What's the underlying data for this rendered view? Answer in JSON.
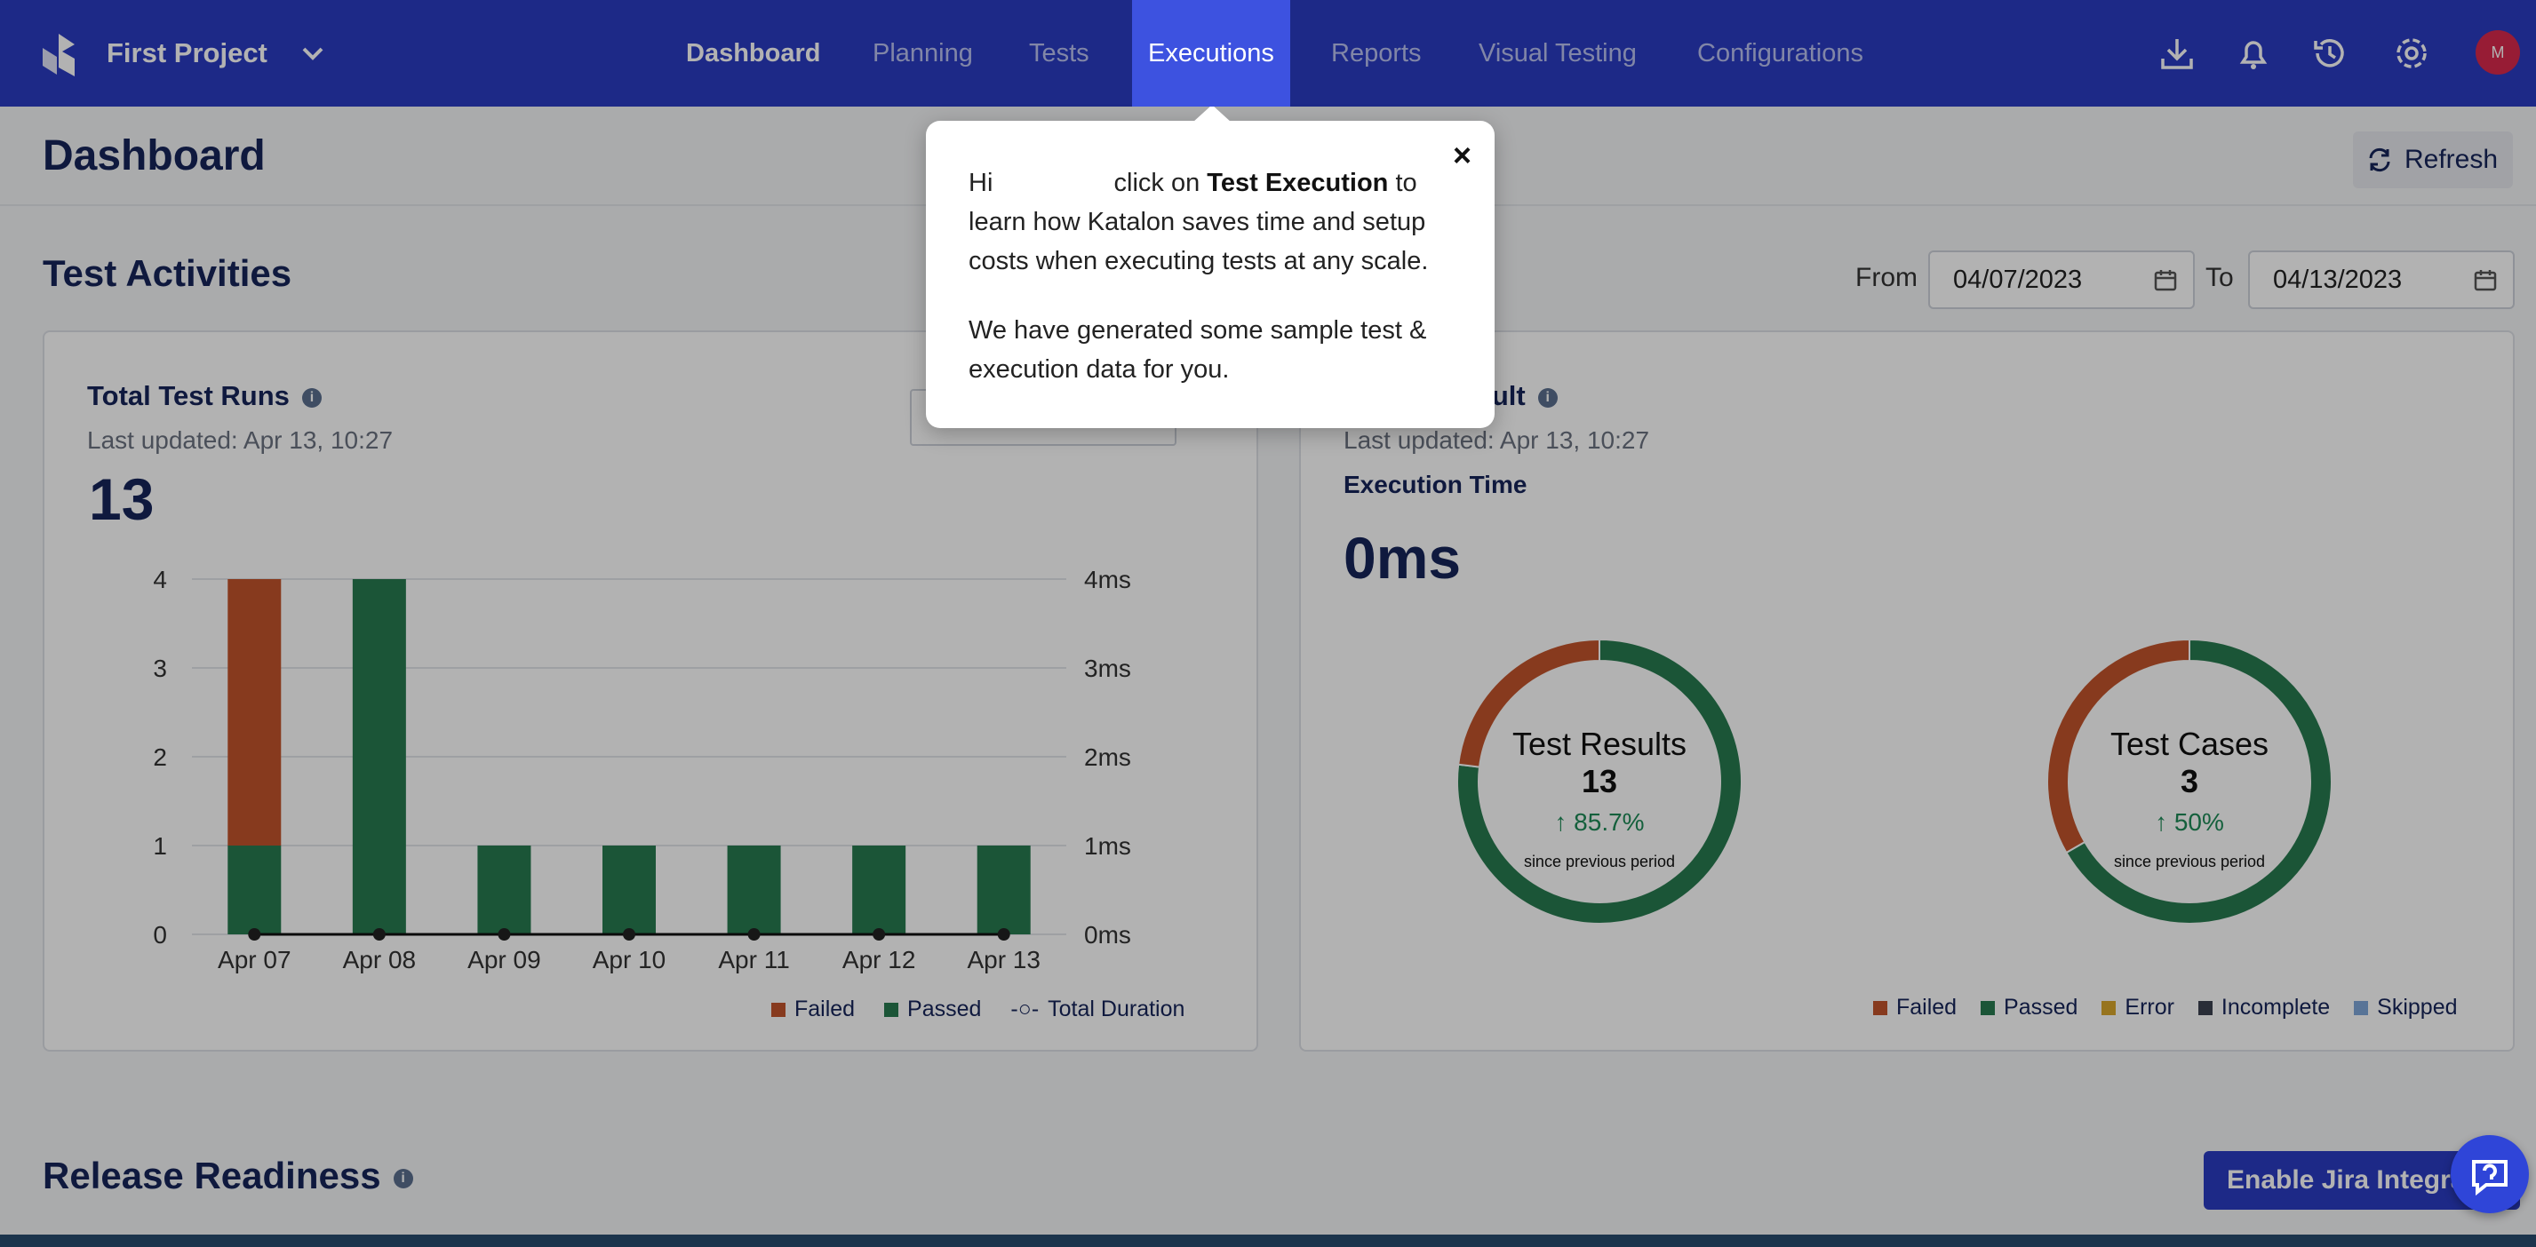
{
  "header": {
    "project": "First Project",
    "nav": [
      "Dashboard",
      "Planning",
      "Tests",
      "Executions",
      "Reports",
      "Visual Testing",
      "Configurations"
    ],
    "avatar_initial": "M",
    "colors": {
      "bar": "#2a3bc2",
      "active_tab": "#3d52e0"
    },
    "icons": [
      "download-icon",
      "bell-icon",
      "history-icon",
      "gear-icon"
    ]
  },
  "page": {
    "title": "Dashboard",
    "refresh_label": "Refresh"
  },
  "activities": {
    "title": "Test Activities",
    "from_label": "From",
    "from_value": "04/07/2023",
    "to_label": "To",
    "to_value": "04/13/2023"
  },
  "total_runs": {
    "title": "Total Test Runs",
    "updated": "Last updated: Apr 13, 10:27",
    "value": "13",
    "legend": [
      "Failed",
      "Passed",
      "Total Duration"
    ]
  },
  "result": {
    "title_visible": "Result",
    "updated": "Last updated: Apr 13, 10:27",
    "exec_label": "Execution Time",
    "exec_value": "0ms",
    "donut1": {
      "title": "Test Results",
      "value": "13",
      "change": "↑ 85.7%",
      "caption": "since previous period"
    },
    "donut2": {
      "title": "Test Cases",
      "value": "3",
      "change": "↑ 50%",
      "caption": "since previous period"
    },
    "legend": [
      "Failed",
      "Passed",
      "Error",
      "Incomplete",
      "Skipped"
    ]
  },
  "release": {
    "title": "Release Readiness",
    "jira_label": "Enable Jira Integration"
  },
  "tooltip": {
    "hi": "Hi",
    "p1a": "click on",
    "p1b": "Test Execution",
    "p1c": "to learn how Katalon saves time and setup costs when executing tests at any scale.",
    "p2": "We have generated some sample test & execution data for you.",
    "close": "×"
  },
  "chart_data": [
    {
      "type": "bar",
      "stacked": true,
      "categories": [
        "Apr 07",
        "Apr 08",
        "Apr 09",
        "Apr 10",
        "Apr 11",
        "Apr 12",
        "Apr 13"
      ],
      "series": [
        {
          "name": "Failed",
          "values": [
            3,
            0,
            0,
            0,
            0,
            0,
            0
          ],
          "color": "#c2542b"
        },
        {
          "name": "Passed",
          "values": [
            1,
            4,
            1,
            1,
            1,
            1,
            1
          ],
          "color": "#287a4f"
        },
        {
          "name": "Total Duration",
          "type": "line",
          "values": [
            0,
            0,
            0,
            0,
            0,
            0,
            0
          ],
          "color": "#111111"
        }
      ],
      "ylim": [
        0,
        4
      ],
      "yticks": [
        "0",
        "1",
        "2",
        "3",
        "4"
      ],
      "y2ticks": [
        "0ms",
        "1ms",
        "2ms",
        "3ms",
        "4ms"
      ],
      "grid": true,
      "legend": "bottom-right"
    },
    {
      "type": "pie",
      "title": "Test Results",
      "labels": [
        "Failed",
        "Passed"
      ],
      "values": [
        3,
        10
      ],
      "colors": [
        "#c2542b",
        "#287a4f"
      ]
    },
    {
      "type": "pie",
      "title": "Test Cases",
      "labels": [
        "Failed",
        "Passed"
      ],
      "values": [
        1,
        2
      ],
      "colors": [
        "#c2542b",
        "#287a4f"
      ]
    }
  ]
}
